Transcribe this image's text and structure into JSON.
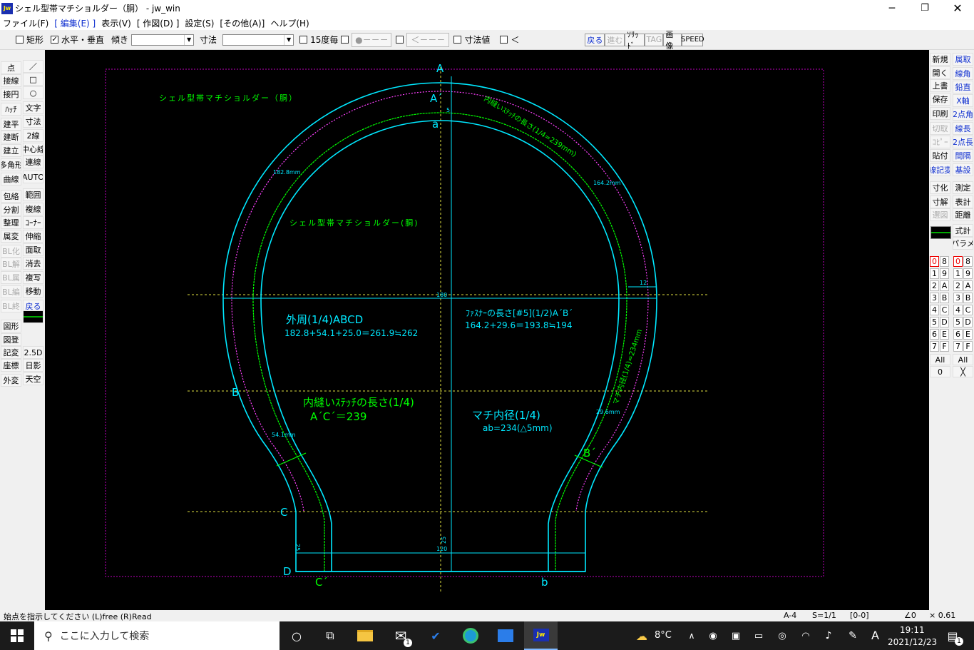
{
  "window": {
    "title": "シェル型帯マチショルダー（胴） - jw_win",
    "app_icon_label": "Jw"
  },
  "menu": [
    "ファイル(F)",
    "[ 編集(E) ]",
    "表示(V)",
    "[ 作図(D) ]",
    "設定(S)",
    "[その他(A)]",
    "ヘルプ(H)"
  ],
  "toolbar": {
    "rect_label": "矩形",
    "hv_check": "✓",
    "hv_label": "水平・垂直",
    "tilt_label": "傾き",
    "dim_label": "寸法",
    "deg15_label": "15度毎",
    "line_style": "●－－－",
    "arrow_style": "＜－－－",
    "dimval_label": "寸法値",
    "lt_label": "＜",
    "right_btns": [
      "戻る",
      "進む",
      "ｿﾘｯﾄﾞ",
      "TAG",
      "画像",
      "SPEED"
    ]
  },
  "left_tools_col1": [
    "点",
    "接線",
    "接円",
    "ﾊｯﾁ",
    "建平",
    "建断",
    "建立",
    "多角形",
    "曲線",
    "包絡",
    "分割",
    "整理",
    "属変",
    "BL化",
    "BL解",
    "BL属",
    "BL編",
    "BL終",
    "図形",
    "図登",
    "記変",
    "座標",
    "外変"
  ],
  "left_tools_col2": [
    "／",
    "□",
    "○",
    "文字",
    "寸法",
    "2線",
    "中心線",
    "連線",
    "AUTO",
    "範囲",
    "複線",
    "ｺｰﾅｰ",
    "伸縮",
    "面取",
    "消去",
    "複写",
    "移動",
    "戻る",
    "",
    "2.5D",
    "日影",
    "天空"
  ],
  "right_tools_col1": [
    "新規",
    "開く",
    "上書",
    "保存",
    "印刷",
    "切取",
    "ｺﾋﾟｰ",
    "貼付",
    "線記変",
    "",
    "寸化",
    "寸解",
    "選図"
  ],
  "right_tools_col2": [
    "属取",
    "線角",
    "鉛直",
    "X軸",
    "2点角",
    "線長",
    "2点長",
    "間隔",
    "基設",
    "",
    "測定",
    "表計",
    "距離",
    "",
    "式計",
    "パラメ"
  ],
  "layer_groups": {
    "col1": [
      "0",
      "1",
      "2",
      "3",
      "4",
      "5",
      "6",
      "7"
    ],
    "col2": [
      "8",
      "9",
      "A",
      "B",
      "C",
      "D",
      "E",
      "F"
    ],
    "all_label": "All",
    "zero_label": "0",
    "x_label": "╳"
  },
  "drawing": {
    "title_top": "シェル型帯マチショルダー（胴）",
    "title_center": "シェル型帯マチショルダー(胴)",
    "stitch_arc_label": "内縫いｽﾃｯﾁの長さ(1/4=239mm)",
    "dim_182": "182.8mm",
    "dim_164": "164.2mm",
    "dim_54": "54.1mm",
    "dim_29": "29.6mm",
    "dim_12": "12",
    "dim_180": "180",
    "dim_120": "120",
    "dim_25a": "25",
    "dim_25b": "25",
    "dim_a_small": "5",
    "inner_arc_label": "マチ内径(1/4)=234mm",
    "outer_title": "外周(1/4)ABCD",
    "outer_formula": "182.8+54.1+25.0＝261.9≒262",
    "fastener_title": "ﾌｧｽﾅｰの長さ[#5](1/2)A´B´",
    "fastener_formula": "164.2+29.6＝193.8≒194",
    "stitch_title": "内縫いｽﾃｯﾁの長さ(1/4)",
    "stitch_formula": "A´C´＝239",
    "inner_title": "マチ内径(1/4)",
    "inner_formula": "ab=234(△5mm)",
    "pt_A": "A",
    "pt_A2": "A´",
    "pt_a": "a",
    "pt_B": "B",
    "pt_B2": "B´",
    "pt_C": "C",
    "pt_C2": "C´",
    "pt_D": "D",
    "pt_b": "b"
  },
  "status": {
    "message": "始点を指示してください (L)free (R)Read",
    "paper": "A-4",
    "scale": "S=1/1",
    "layer": "[0-0]",
    "angle": "∠0",
    "zoom": "× 0.61"
  },
  "taskbar": {
    "search_placeholder": "ここに入力して検索",
    "temp": "8°C",
    "ime": "A",
    "time": "19:11",
    "date": "2021/12/23",
    "mail_badge": "1",
    "notif_badge": "1"
  },
  "colors": {
    "cyan": "#00ffff",
    "green": "#00ff00",
    "magenta": "#ff40ff",
    "yellow": "#ffff40",
    "border": "#c000c0"
  }
}
